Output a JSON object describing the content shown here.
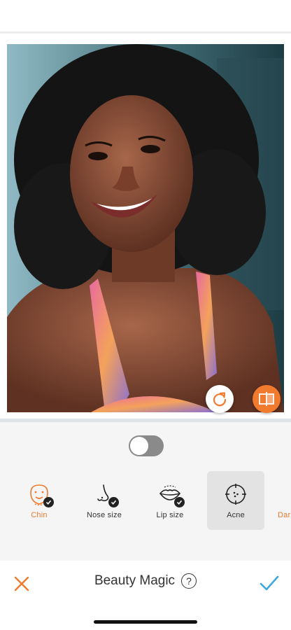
{
  "photo": {
    "description_icon": "portrait-photo",
    "reset_icon": "refresh-icon",
    "compare_icon": "compare-icon"
  },
  "toggle": {
    "state": "off"
  },
  "tools": [
    {
      "label": "Chin",
      "icon": "chin-icon",
      "applied": true,
      "active": true
    },
    {
      "label": "Nose size",
      "icon": "nose-icon",
      "applied": true
    },
    {
      "label": "Lip size",
      "icon": "lips-icon",
      "applied": true
    },
    {
      "label": "Acne",
      "icon": "acne-icon",
      "selected": true
    },
    {
      "label": "Dar"
    }
  ],
  "bottom_bar": {
    "title": "Beauty Magic",
    "help": "?",
    "cancel_icon": "close-icon",
    "apply_icon": "checkmark-icon"
  },
  "colors": {
    "accent": "#f07a2e",
    "apply": "#3fa8e0"
  }
}
